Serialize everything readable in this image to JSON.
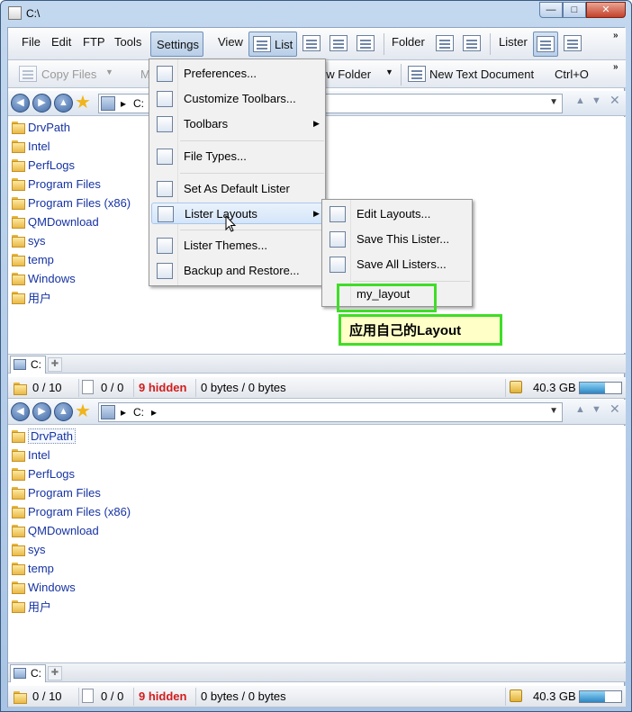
{
  "window": {
    "title": "C:\\"
  },
  "toolbar1": {
    "file": "File",
    "edit": "Edit",
    "ftp": "FTP",
    "tools": "Tools",
    "settings": "Settings",
    "view": "View",
    "list": "List",
    "folder": "Folder",
    "lister": "Lister",
    "overflow": "»"
  },
  "toolbar2": {
    "copy_files": "Copy Files",
    "move_truncated": "M",
    "new_folder": "ew Folder",
    "new_text_document": "New Text Document",
    "shortcut": "Ctrl+O",
    "overflow": "»"
  },
  "pane_top": {
    "path": "C:",
    "files": [
      "DrvPath",
      "Intel",
      "PerfLogs",
      "Program Files",
      "Program Files (x86)",
      "QMDownload",
      "sys",
      "temp",
      "Windows",
      "用户"
    ],
    "tab_label": "C:",
    "status": {
      "folders": "0 / 10",
      "files": "0 / 0",
      "hidden": "9 hidden",
      "bytes": "0 bytes / 0 bytes",
      "free": "40.3 GB",
      "free_fill": 0.6
    }
  },
  "pane_bottom": {
    "path": "C:",
    "files": [
      "DrvPath",
      "Intel",
      "PerfLogs",
      "Program Files",
      "Program Files (x86)",
      "QMDownload",
      "sys",
      "temp",
      "Windows",
      "用户"
    ],
    "tab_label": "C:",
    "status": {
      "folders": "0 / 10",
      "files": "0 / 0",
      "hidden": "9 hidden",
      "bytes": "0 bytes / 0 bytes",
      "free": "40.3 GB",
      "free_fill": 0.6
    }
  },
  "settings_menu": {
    "items": [
      "Preferences...",
      "Customize Toolbars...",
      "Toolbars",
      "File Types...",
      "Set As Default Lister",
      "Lister Layouts",
      "Lister Themes...",
      "Backup and Restore..."
    ]
  },
  "layouts_submenu": {
    "items": [
      "Edit Layouts...",
      "Save This Lister...",
      "Save All Listers...",
      "my_layout"
    ]
  },
  "annotation": {
    "text": "应用自己的Layout",
    "color": "#3fdd27"
  }
}
